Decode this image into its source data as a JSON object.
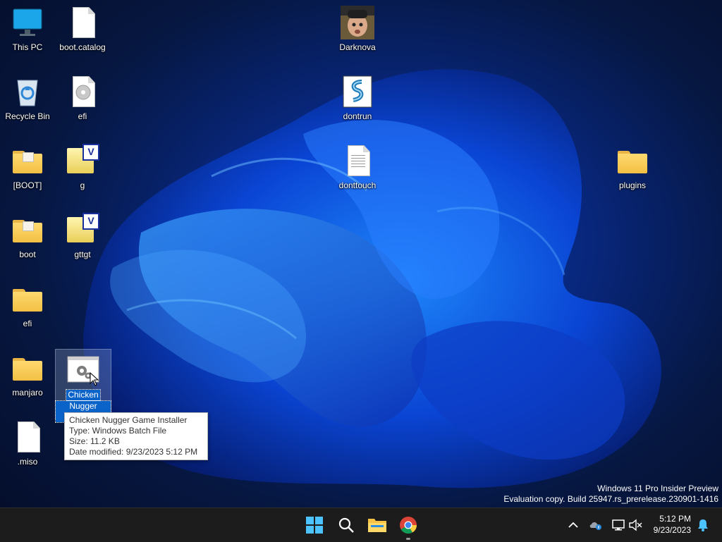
{
  "desktop": {
    "icons": {
      "this_pc": "This PC",
      "boot_catalog": "boot.catalog",
      "darknova": "Darknova",
      "recycle_bin": "Recycle Bin",
      "efi_file": "efi",
      "dontrun": "dontrun",
      "boot_bracket": "[BOOT]",
      "g": "g",
      "donttouch": "donttouch",
      "plugins": "plugins",
      "boot": "boot",
      "gttgt": "gttgt",
      "efi_folder": "efi",
      "manjaro": "manjaro",
      "miso": ".miso"
    },
    "selected_icon": {
      "label_line1": "Chicken",
      "label_line2": "Nugger Game"
    },
    "tooltip": {
      "name": "Chicken Nugger Game Installer",
      "type": "Type: Windows Batch File",
      "size": "Size: 11.2 KB",
      "modified": "Date modified: 9/23/2023 5:12 PM"
    },
    "watermark": {
      "line1": "Windows 11 Pro Insider Preview",
      "line2": "Evaluation copy. Build 25947.rs_prerelease.230901-1416"
    }
  },
  "taskbar": {
    "pinned": [
      "start-icon",
      "search-icon",
      "file-explorer-icon",
      "chrome-icon"
    ],
    "tray_icons": [
      "chevron-up-icon",
      "onedrive-icon",
      "network-icon",
      "volume-muted-icon",
      "notification-bell-icon"
    ],
    "clock": {
      "time": "5:12 PM",
      "date": "9/23/2023"
    }
  },
  "colors": {
    "accent": "#0a63c9",
    "taskbar": "#1c1c1c",
    "windows_logo": "#4cc2ff"
  }
}
